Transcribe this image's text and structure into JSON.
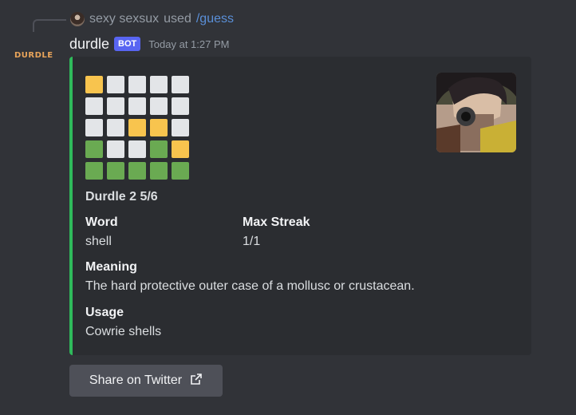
{
  "reply": {
    "user": "sexy sexsux",
    "action": "used",
    "command": "/guess"
  },
  "message": {
    "bot_logo_text": "DURDLE",
    "username": "durdle",
    "badge": "BOT",
    "timestamp": "Today at 1:27 PM"
  },
  "embed": {
    "accent_color": "#2fba5b",
    "grid": [
      [
        "yellow",
        "gray",
        "gray",
        "gray",
        "gray"
      ],
      [
        "gray",
        "gray",
        "gray",
        "gray",
        "gray"
      ],
      [
        "gray",
        "gray",
        "yellow",
        "yellow",
        "gray"
      ],
      [
        "green",
        "gray",
        "gray",
        "green",
        "yellow"
      ],
      [
        "green",
        "green",
        "green",
        "green",
        "green"
      ]
    ],
    "title": "Durdle 2 5/6",
    "fields": {
      "word_name": "Word",
      "word_value": "shell",
      "streak_name": "Max Streak",
      "streak_value": "1/1",
      "meaning_name": "Meaning",
      "meaning_value": "The hard protective outer case of a mollusc or crustacean.",
      "usage_name": "Usage",
      "usage_value": "Cowrie shells"
    }
  },
  "button": {
    "label": "Share on Twitter",
    "icon": "external-link-icon"
  }
}
